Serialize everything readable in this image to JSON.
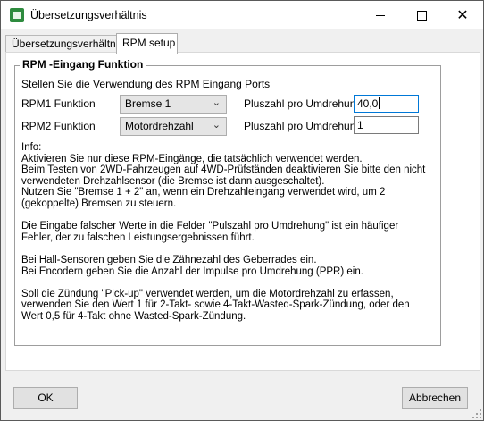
{
  "window": {
    "title": "Übersetzungsverhältnis",
    "minimize_icon": "minimize-icon",
    "maximize_icon": "maximize-icon",
    "close_icon": "close-icon",
    "app_icon": "app-icon"
  },
  "tabs": [
    {
      "label": "Übersetzungsverhältnis",
      "selected": false
    },
    {
      "label": "RPM setup",
      "selected": true
    }
  ],
  "group": {
    "title": "RPM -Eingang Funktion",
    "intro": "Stellen Sie die Verwendung des RPM Eingang Ports",
    "rows": [
      {
        "label": "RPM1 Funktion",
        "select_value": "Bremse 1",
        "pulse_label": "Pluszahl pro Umdrehung:",
        "pulse_value": "40,0"
      },
      {
        "label": "RPM2 Funktion",
        "select_value": "Motordrehzahl",
        "pulse_label": "Pluszahl pro Umdrehung:",
        "pulse_value": "1"
      }
    ],
    "info": [
      "Info:",
      "Aktivieren Sie nur diese RPM-Eingänge, die tatsächlich verwendet werden.\nBeim Testen von 2WD-Fahrzeugen auf 4WD-Prüfständen deaktivieren Sie bitte den nicht verwendeten Drehzahlsensor (die Bremse ist dann ausgeschaltet).\nNutzen Sie \"Bremse 1 + 2\" an, wenn ein Drehzahleingang verwendet wird, um 2 (gekoppelte) Bremsen zu steuern.",
      "Die Eingabe falscher Werte in die Felder \"Pulszahl pro Umdrehung\" ist ein häufiger Fehler, der zu falschen Leistungsergebnissen führt.",
      "Bei Hall-Sensoren geben Sie die Zähnezahl des Geberrades ein.\nBei Encodern geben Sie die Anzahl der Impulse pro Umdrehung (PPR) ein.",
      "Soll die Zündung \"Pick-up\" verwendet werden, um die Motordrehzahl zu erfassen, verwenden Sie den Wert 1 für 2-Takt- sowie 4-Takt-Wasted-Spark-Zündung, oder den Wert 0,5 für 4-Takt ohne Wasted-Spark-Zündung."
    ]
  },
  "buttons": {
    "ok": "OK",
    "cancel": "Abbrechen"
  },
  "colors": {
    "focus_border": "#0078d7",
    "app_icon_green": "#2e8b3e"
  }
}
